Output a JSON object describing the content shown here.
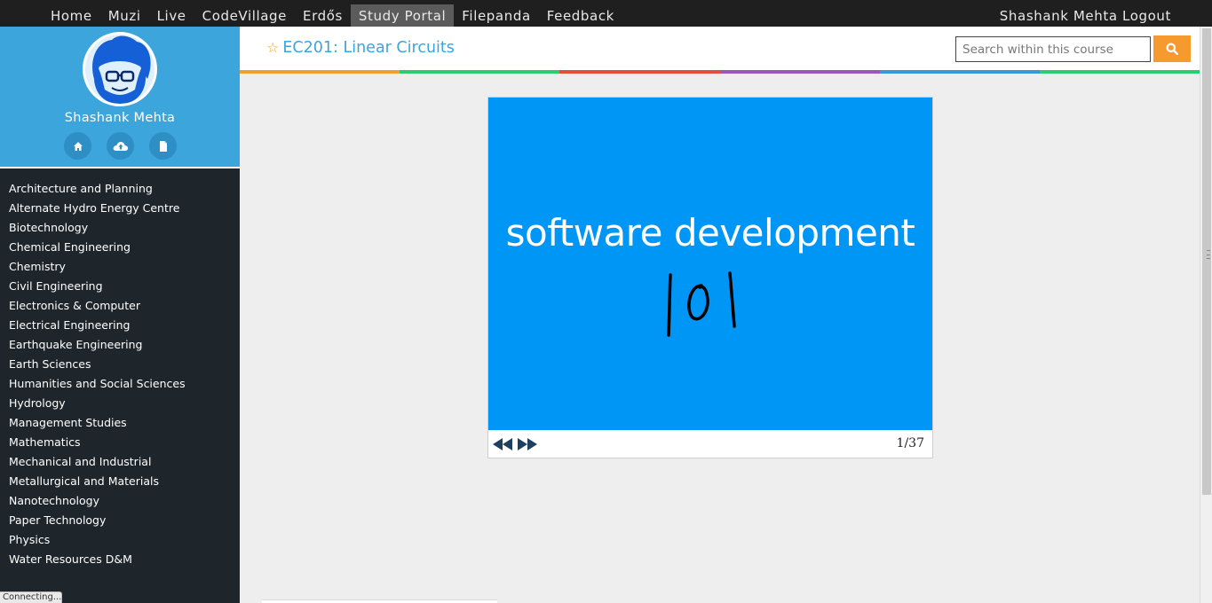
{
  "nav": {
    "items": [
      {
        "label": "Home",
        "active": false
      },
      {
        "label": "Muzi",
        "active": false
      },
      {
        "label": "Live",
        "active": false
      },
      {
        "label": "CodeVillage",
        "active": false
      },
      {
        "label": "Erdős",
        "active": false
      },
      {
        "label": "Study Portal",
        "active": true
      },
      {
        "label": "Filepanda",
        "active": false
      },
      {
        "label": "Feedback",
        "active": false
      }
    ],
    "user_name": "Shashank Mehta",
    "logout_label": "Logout"
  },
  "profile": {
    "name": "Shashank Mehta",
    "icons": [
      "home-icon",
      "cloud-upload-icon",
      "document-icon"
    ]
  },
  "departments": [
    "Architecture and Planning",
    "Alternate Hydro Energy Centre",
    "Biotechnology",
    "Chemical Engineering",
    "Chemistry",
    "Civil Engineering",
    "Electronics & Computer",
    "Electrical Engineering",
    "Earthquake Engineering",
    "Earth Sciences",
    "Humanities and Social Sciences",
    "Hydrology",
    "Management Studies",
    "Mathematics",
    "Mechanical and Industrial",
    "Metallurgical and Materials",
    "Nanotechnology",
    "Paper Technology",
    "Physics",
    "Water Resources D&M"
  ],
  "course": {
    "title": "EC201: Linear Circuits",
    "star_icon": "star-icon"
  },
  "search": {
    "placeholder": "Search within this course",
    "value": "",
    "button_icon": "search-icon"
  },
  "color_bar": [
    "#f0a030",
    "#2ecc71",
    "#e74c3c",
    "#9b59b6",
    "#3498db",
    "#2ecc71"
  ],
  "slide": {
    "title": "software development",
    "number": "101",
    "background": "#0096f5",
    "page_indicator": "1/37",
    "prev_icon": "rewind-icon",
    "next_icon": "fast-forward-icon"
  },
  "status": {
    "text": "Connecting..."
  }
}
